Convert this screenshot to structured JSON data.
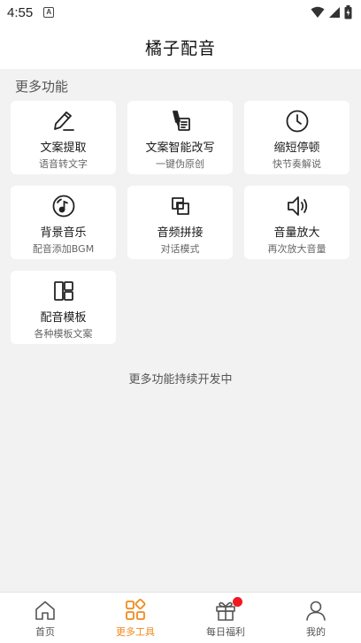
{
  "status": {
    "time": "4:55",
    "notification_glyph": "A"
  },
  "header": {
    "title": "橘子配音"
  },
  "section": {
    "title": "更多功能"
  },
  "features": [
    {
      "title": "文案提取",
      "subtitle": "语音转文字",
      "icon": "pencil-icon"
    },
    {
      "title": "文案智能改写",
      "subtitle": "一键伪原创",
      "icon": "pen-list-icon"
    },
    {
      "title": "缩短停顿",
      "subtitle": "快节奏解说",
      "icon": "clock-icon"
    },
    {
      "title": "背景音乐",
      "subtitle": "配音添加BGM",
      "icon": "music-disc-icon"
    },
    {
      "title": "音频拼接",
      "subtitle": "对话模式",
      "icon": "merge-squares-icon"
    },
    {
      "title": "音量放大",
      "subtitle": "再次放大音量",
      "icon": "speaker-icon"
    },
    {
      "title": "配音模板",
      "subtitle": "各种模板文案",
      "icon": "template-layout-icon"
    }
  ],
  "footer_note": "更多功能持续开发中",
  "tabs": [
    {
      "label": "首页",
      "icon": "home-icon",
      "active": false
    },
    {
      "label": "更多工具",
      "icon": "tools-grid-icon",
      "active": true
    },
    {
      "label": "每日福利",
      "icon": "gift-icon",
      "active": false,
      "badge": true
    },
    {
      "label": "我的",
      "icon": "user-icon",
      "active": false
    }
  ],
  "colors": {
    "accent": "#f08a1c",
    "badge": "#f0191f",
    "background": "#f2f2f2",
    "card": "#ffffff"
  }
}
